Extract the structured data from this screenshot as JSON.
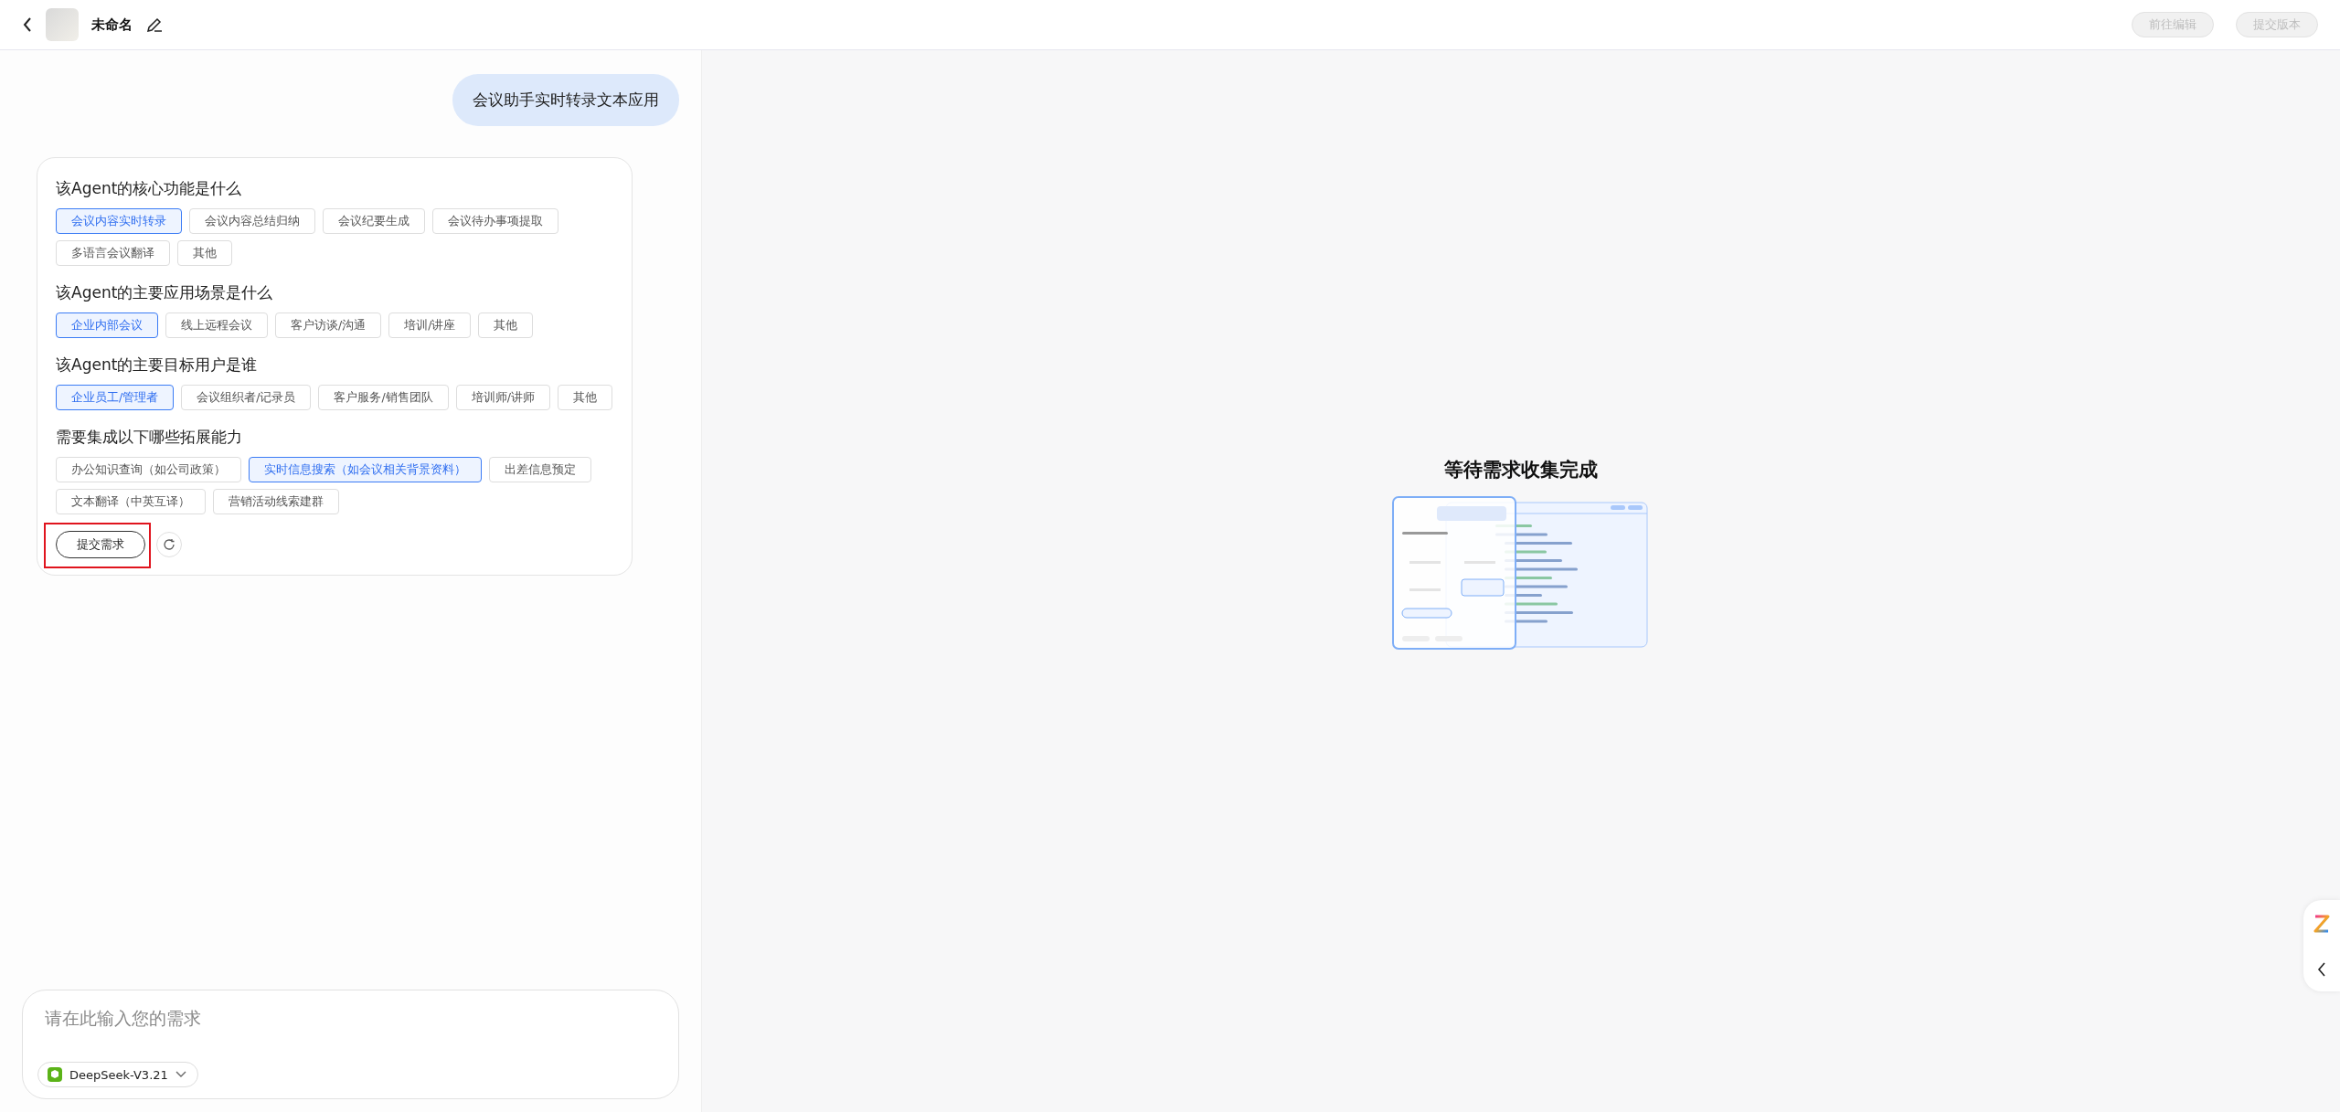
{
  "header": {
    "title": "未命名",
    "buttons": [
      {
        "label": "前往编辑",
        "disabled": true
      },
      {
        "label": "提交版本",
        "disabled": true
      }
    ]
  },
  "chat": {
    "user_message": "会议助手实时转录文本应用",
    "questions": [
      {
        "title": "该Agent的核心功能是什么",
        "options": [
          {
            "label": "会议内容实时转录",
            "selected": true
          },
          {
            "label": "会议内容总结归纳",
            "selected": false
          },
          {
            "label": "会议纪要生成",
            "selected": false
          },
          {
            "label": "会议待办事项提取",
            "selected": false
          },
          {
            "label": "多语言会议翻译",
            "selected": false
          },
          {
            "label": "其他",
            "selected": false
          }
        ]
      },
      {
        "title": "该Agent的主要应用场景是什么",
        "options": [
          {
            "label": "企业内部会议",
            "selected": true
          },
          {
            "label": "线上远程会议",
            "selected": false
          },
          {
            "label": "客户访谈/沟通",
            "selected": false
          },
          {
            "label": "培训/讲座",
            "selected": false
          },
          {
            "label": "其他",
            "selected": false
          }
        ]
      },
      {
        "title": "该Agent的主要目标用户是谁",
        "options": [
          {
            "label": "企业员工/管理者",
            "selected": true
          },
          {
            "label": "会议组织者/记录员",
            "selected": false
          },
          {
            "label": "客户服务/销售团队",
            "selected": false
          },
          {
            "label": "培训师/讲师",
            "selected": false
          },
          {
            "label": "其他",
            "selected": false
          }
        ]
      },
      {
        "title": "需要集成以下哪些拓展能力",
        "options": [
          {
            "label": "办公知识查询（如公司政策）",
            "selected": false
          },
          {
            "label": "实时信息搜索（如会议相关背景资料）",
            "selected": true
          },
          {
            "label": "出差信息预定",
            "selected": false
          },
          {
            "label": "文本翻译（中英互译）",
            "selected": false
          },
          {
            "label": "营销活动线索建群",
            "selected": false
          }
        ]
      }
    ],
    "submit_label": "提交需求"
  },
  "input": {
    "placeholder": "请在此输入您的需求",
    "model": "DeepSeek-V3.21"
  },
  "preview": {
    "status_title": "等待需求收集完成"
  }
}
